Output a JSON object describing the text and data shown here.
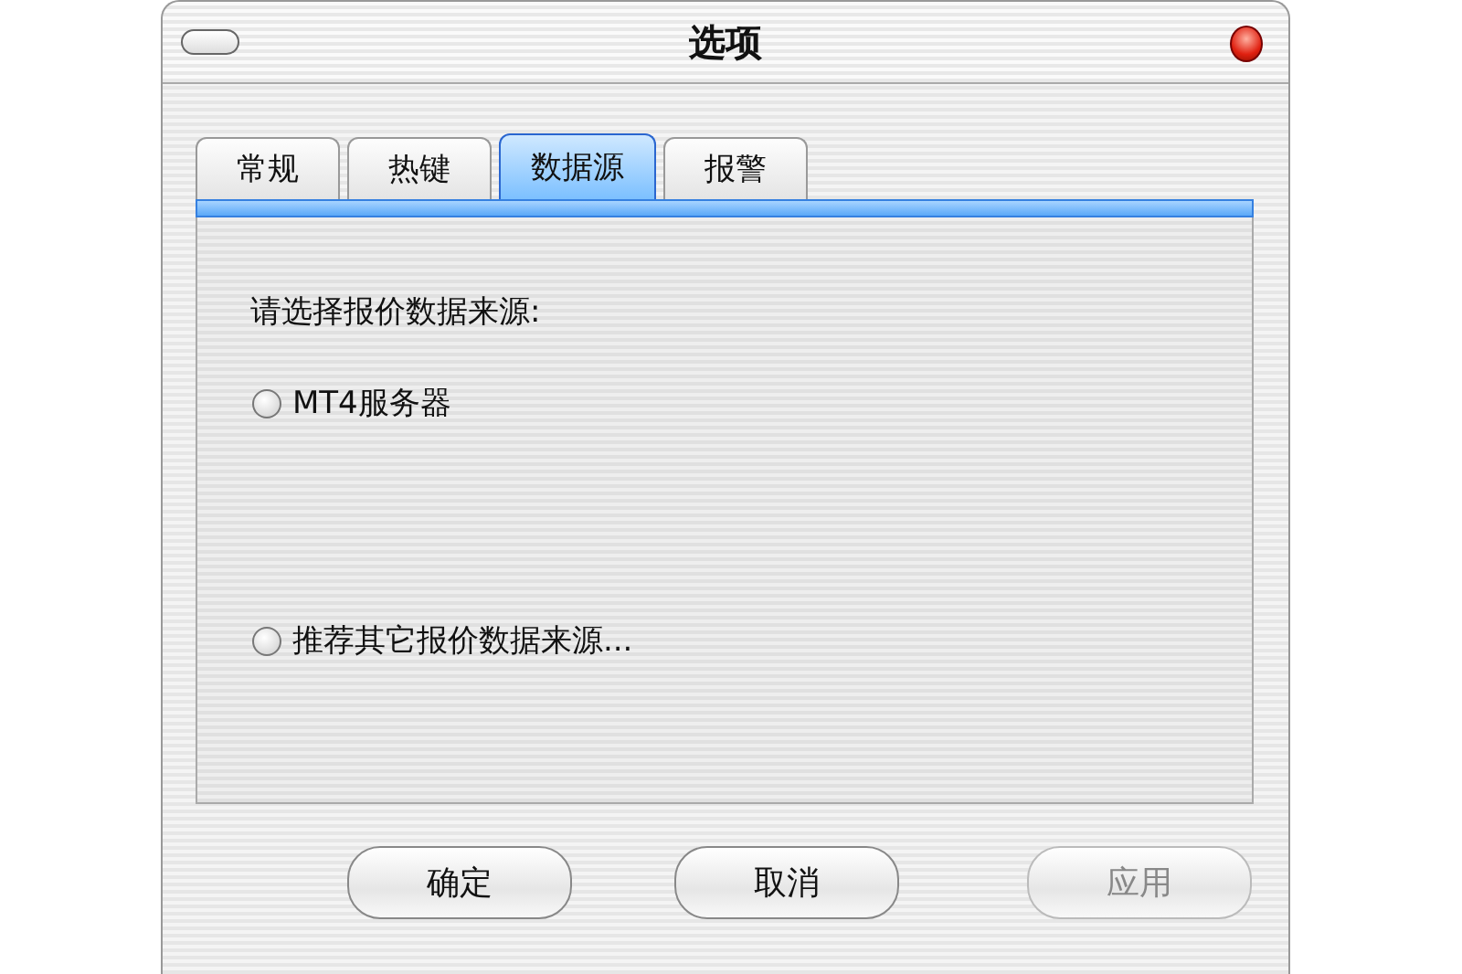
{
  "window": {
    "title": "选项"
  },
  "tabs": [
    {
      "label": "常规",
      "selected": false
    },
    {
      "label": "热键",
      "selected": false
    },
    {
      "label": "数据源",
      "selected": true
    },
    {
      "label": "报警",
      "selected": false
    }
  ],
  "prompt": "请选择报价数据来源:",
  "options": [
    {
      "label": "MT4服务器",
      "checked": false
    },
    {
      "label": "推荐其它报价数据来源...",
      "checked": false
    }
  ],
  "buttons": [
    {
      "label": "确定",
      "disabled": false
    },
    {
      "label": "取消",
      "disabled": false
    },
    {
      "label": "应用",
      "disabled": true
    }
  ]
}
